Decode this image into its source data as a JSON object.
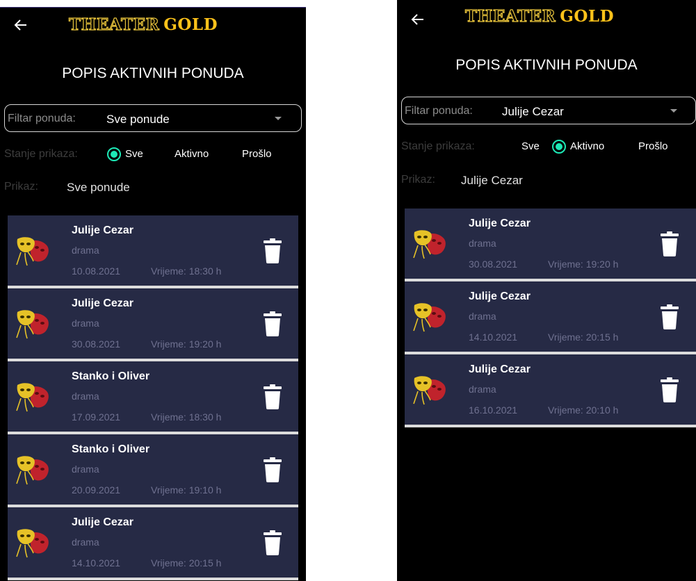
{
  "app": {
    "logo_word1": "THEATER",
    "logo_word2": "GOLD"
  },
  "left": {
    "title": "POPIS AKTIVNIH PONUDA",
    "filter_label": "Filtar ponuda:",
    "filter_value": "Sve ponude",
    "state_label": "Stanje prikaza:",
    "radio_options": [
      "Sve",
      "Aktivno",
      "Prošlo"
    ],
    "radio_selected": "Sve",
    "prikaz_label": "Prikaz:",
    "prikaz_value": "Sve ponude",
    "cards": [
      {
        "title": "Julije Cezar",
        "genre": "drama",
        "date": "10.08.2021",
        "time": "Vrijeme: 18:30 h"
      },
      {
        "title": "Julije Cezar",
        "genre": "drama",
        "date": "30.08.2021",
        "time": "Vrijeme: 19:20 h"
      },
      {
        "title": "Stanko i Oliver",
        "genre": "drama",
        "date": "17.09.2021",
        "time": "Vrijeme: 18:30 h"
      },
      {
        "title": "Stanko i Oliver",
        "genre": "drama",
        "date": "20.09.2021",
        "time": "Vrijeme: 19:10 h"
      },
      {
        "title": "Julije Cezar",
        "genre": "drama",
        "date": "14.10.2021",
        "time": "Vrijeme: 20:15 h"
      }
    ]
  },
  "right": {
    "title": "POPIS AKTIVNIH PONUDA",
    "filter_label": "Filtar ponuda:",
    "filter_value": "Julije Cezar",
    "state_label": "Stanje prikaza:",
    "radio_options": [
      "Sve",
      "Aktivno",
      "Prošlo"
    ],
    "radio_selected": "Aktivno",
    "prikaz_label": "Prikaz:",
    "prikaz_value": "Julije Cezar",
    "cards": [
      {
        "title": "Julije Cezar",
        "genre": "drama",
        "date": "30.08.2021",
        "time": "Vrijeme: 19:20 h"
      },
      {
        "title": "Julije Cezar",
        "genre": "drama",
        "date": "14.10.2021",
        "time": "Vrijeme: 20:15 h"
      },
      {
        "title": "Julije Cezar",
        "genre": "drama",
        "date": "16.10.2021",
        "time": "Vrijeme: 20:10 h"
      }
    ]
  },
  "colors": {
    "background": "#000000",
    "card": "#262a45",
    "accent_radio": "#1de9b6",
    "logo_gold": "#ffc21a",
    "muted_text": "#6f7190"
  },
  "icons": [
    "back-arrow-icon",
    "dropdown-caret-icon",
    "theater-mask-icon",
    "trash-icon"
  ]
}
